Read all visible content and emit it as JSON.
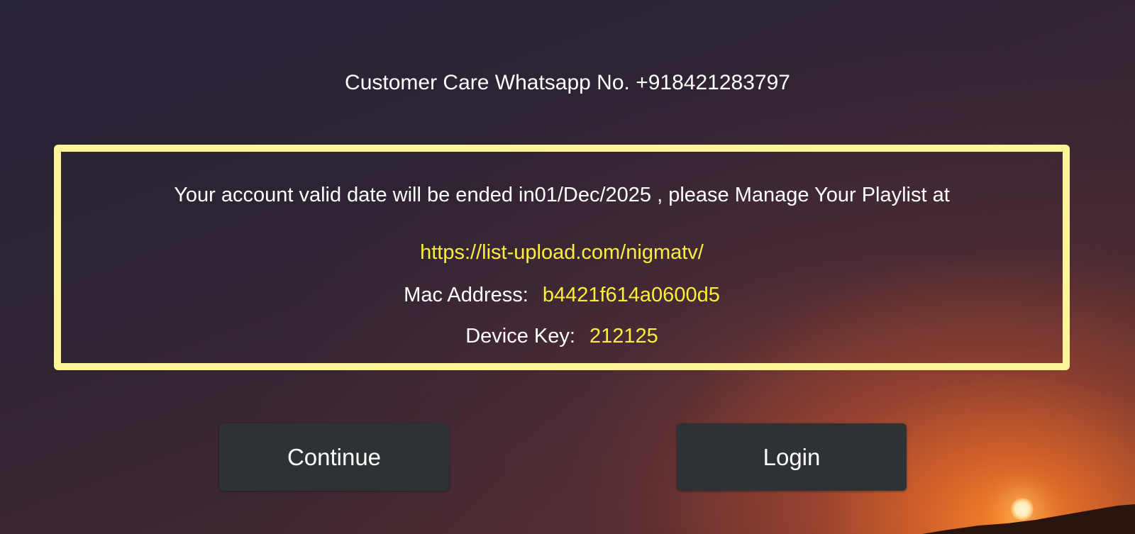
{
  "header": {
    "customer_care": "Customer Care Whatsapp No. +918421283797"
  },
  "notice": {
    "account_message": "Your account valid date will be ended in01/Dec/2025 , please Manage Your Playlist at",
    "playlist_url": "https://list-upload.com/nigmatv/",
    "mac_label": "Mac Address:",
    "mac_value": "b4421f614a0600d5",
    "device_key_label": "Device Key:",
    "device_key_value": "212125"
  },
  "actions": {
    "continue_label": "Continue",
    "login_label": "Login"
  },
  "colors": {
    "box_border": "#fdf49a",
    "highlight_text": "#fcee3e",
    "button_bg": "#2f3235"
  }
}
